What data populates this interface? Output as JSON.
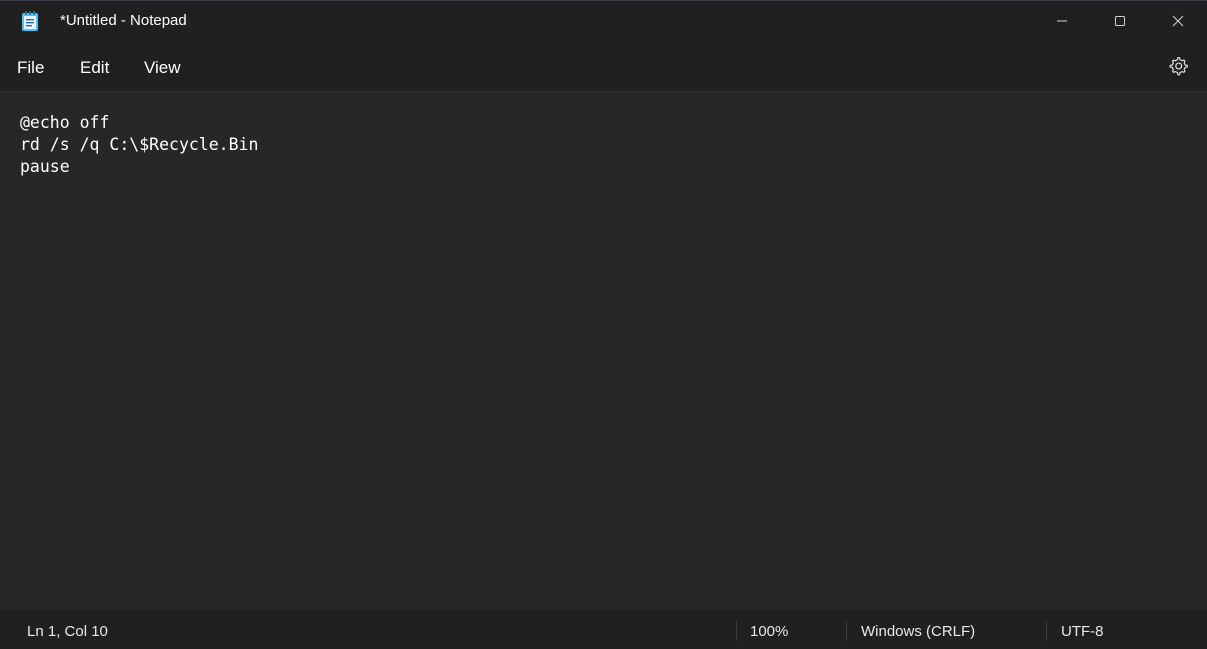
{
  "window": {
    "title": "*Untitled - Notepad"
  },
  "icons": {
    "app": "notepad-icon",
    "minimize": "minimize-icon",
    "maximize": "maximize-icon",
    "close": "close-icon",
    "settings": "gear-icon"
  },
  "menu": {
    "file": "File",
    "edit": "Edit",
    "view": "View"
  },
  "editor": {
    "content": "@echo off\nrd /s /q C:\\$Recycle.Bin\npause"
  },
  "status": {
    "position": "Ln 1, Col 10",
    "zoom": "100%",
    "line_ending": "Windows (CRLF)",
    "encoding": "UTF-8"
  },
  "colors": {
    "background": "#202020",
    "editor_background": "#272727",
    "icon_accent": "#4cc2ff"
  }
}
